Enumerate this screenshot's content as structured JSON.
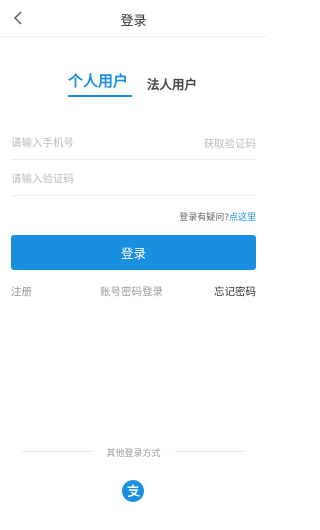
{
  "header": {
    "title": "登录",
    "back_icon": "chevron-left-icon"
  },
  "tabs": [
    {
      "label": "个人用户",
      "active": true
    },
    {
      "label": "法人用户",
      "active": false
    }
  ],
  "form": {
    "phone_placeholder": "请输入手机号",
    "phone_value": "",
    "get_code_label": "获取验证码",
    "code_placeholder": "请输入验证码",
    "code_value": ""
  },
  "help": {
    "text": "登录有疑问?",
    "link": "点这里"
  },
  "login_button": "登录",
  "links": {
    "register": "注册",
    "password_login": "账号密码登录",
    "forgot_password": "忘记密码"
  },
  "other_login": {
    "label": "其他登录方式",
    "providers": [
      {
        "icon": "alipay-icon"
      }
    ]
  },
  "colors": {
    "accent": "#1a8fe0",
    "divider": "#eeeeee"
  }
}
